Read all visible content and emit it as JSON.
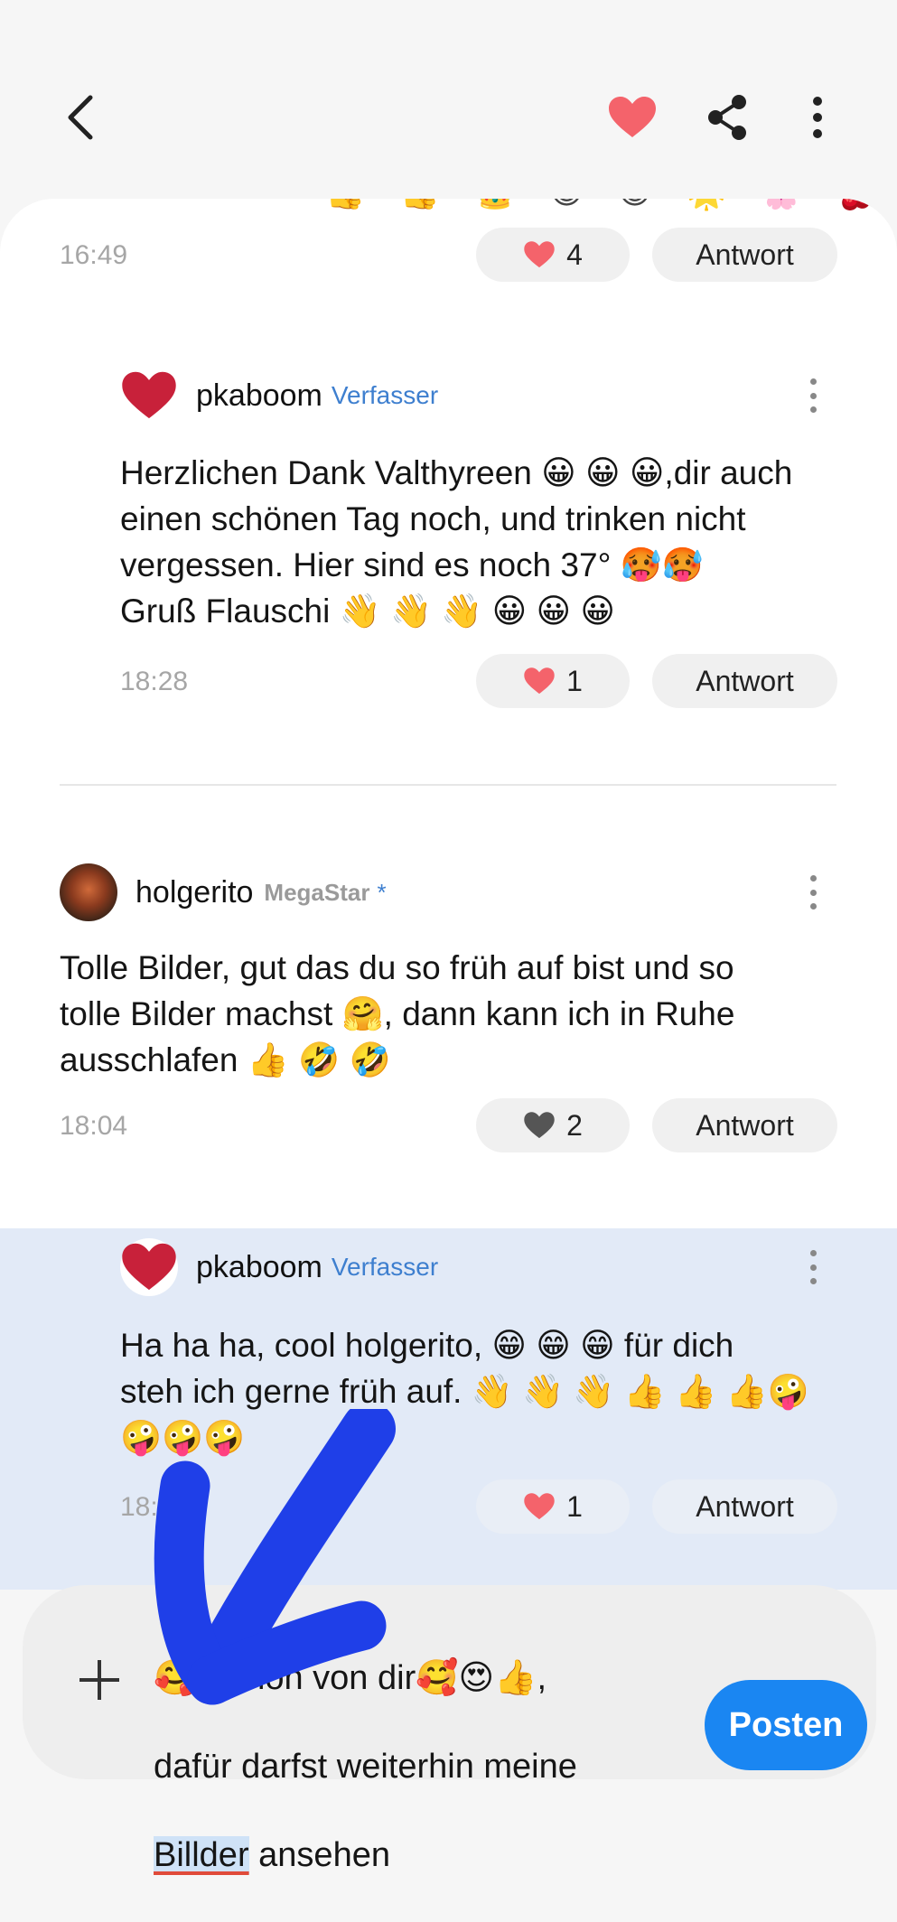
{
  "header": {
    "back_icon": "chevron-left-icon",
    "like_icon": "heart-icon",
    "share_icon": "share-icon",
    "more_icon": "more-vertical-icon",
    "like_color": "#f4636b"
  },
  "partial_emoji": "👍 👍 👑 😄 😄   🌟 🌸 🍒",
  "comments": [
    {
      "time": "16:49",
      "likes": "4",
      "reply": "Antwort"
    },
    {
      "user": "pkaboom",
      "role": "Verfasser",
      "text": "Herzlichen Dank Valthyreen 😀 😀 😀,dir auch\neinen schönen Tag noch, und trinken nicht\nvergessen. Hier sind es noch 37° 🥵🥵\nGruß Flauschi 👋 👋 👋 😀 😀 😀",
      "time": "18:28",
      "likes": "1",
      "reply": "Antwort"
    },
    {
      "user": "holgerito",
      "role": "MegaStar",
      "star": "*",
      "text": "Tolle Bilder, gut das du so früh auf bist und so\ntolle Bilder machst 🤗, dann kann ich in Ruhe\nausschlafen 👍 🤣 🤣",
      "time": "18:04",
      "likes": "2",
      "reply": "Antwort"
    },
    {
      "user": "pkaboom",
      "role": "Verfasser",
      "text": "Ha ha ha, cool holgerito, 😁 😁 😁 für dich\nsteh ich gerne früh auf. 👋 👋 👋 👍 👍 👍🤪\n🤪🤪🤪",
      "time": "18:",
      "likes": "1",
      "reply": "Antwort"
    }
  ],
  "composer": {
    "line1": "🥰 Schön von dir🥰😍👍,",
    "line2": "dafür darfst weiterhin meine",
    "word_underlined": "Billder",
    "line3_rest": " ansehen",
    "post_label": "Posten",
    "plus_icon": "plus-icon"
  },
  "colors": {
    "accent": "#1a86f2",
    "highlight": "#e2eaf7",
    "annotation": "#1f3fe8"
  }
}
